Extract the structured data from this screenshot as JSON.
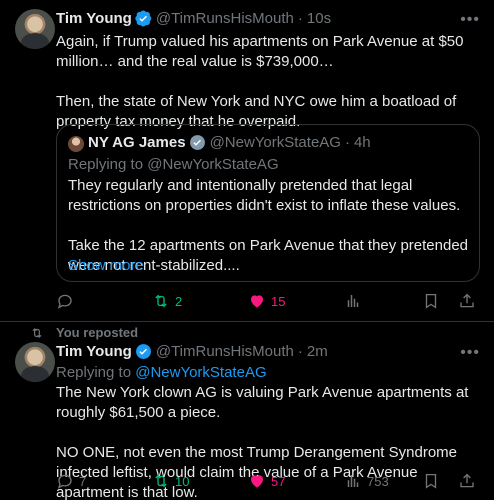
{
  "tweet1": {
    "name": "Tim Young",
    "handle": "@TimRunsHisMouth",
    "separator": "·",
    "time": "10s",
    "para1": "Again, if Trump valued his apartments on Park Avenue at $50 million… and the real value is $739,000…",
    "para2": "Then, the state of New York and NYC owe him a boatload of property tax money that he overpaid.",
    "quote": {
      "name": "NY AG James",
      "handle": "@NewYorkStateAG",
      "separator": "·",
      "time": "4h",
      "replying": "Replying to @NewYorkStateAG",
      "para1": "They regularly and intentionally pretended that legal restrictions on properties didn't exist to inflate these values.",
      "para2": "Take the 12 apartments on Park Avenue that they pretended were not rent-stabilized....",
      "show_more": "Show more"
    },
    "retweets": "2",
    "likes": "15"
  },
  "repost_label": "You reposted",
  "tweet2": {
    "name": "Tim Young",
    "handle": "@TimRunsHisMouth",
    "separator": "·",
    "time": "2m",
    "replying_prefix": "Replying to ",
    "replying_handle": "@NewYorkStateAG",
    "para1": "The New York clown AG is valuing Park Avenue apartments at roughly $61,500 a piece.",
    "para2": "NO ONE, not even the most Trump Derangement Syndrome infected leftist, would claim the value of a Park Avenue apartment is that low.",
    "replies": "7",
    "retweets": "10",
    "likes": "57",
    "views": "753"
  },
  "colors": {
    "background": "#000000",
    "text": "#e7e9ea",
    "muted": "#71767b",
    "accent_blue": "#1d9bf0",
    "retweet_green": "#00ba7c",
    "like_pink": "#f91880"
  }
}
